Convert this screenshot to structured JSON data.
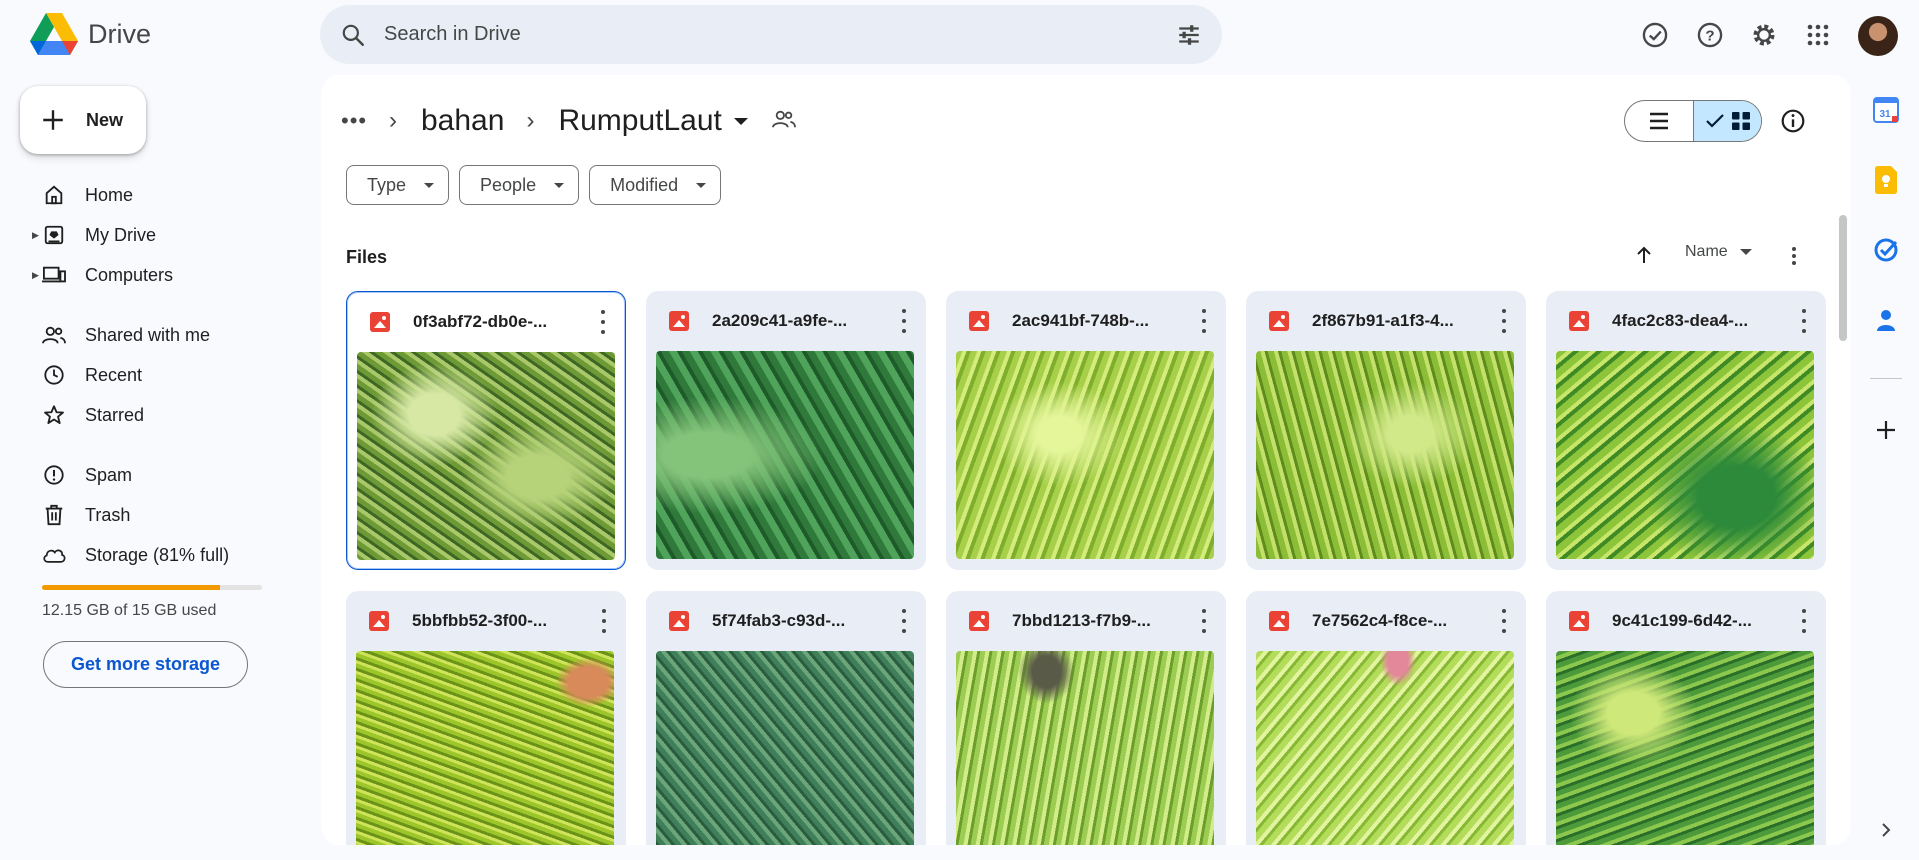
{
  "app": {
    "name": "Drive",
    "colors": {
      "accent": "#0b57d0",
      "storage": "#f29900",
      "selected_view": "#c2e7ff",
      "card_bg": "#e9eef6"
    }
  },
  "search": {
    "placeholder": "Search in Drive",
    "icon": "search-icon",
    "options_icon": "tune-icon"
  },
  "header_icons": [
    "ready-for-offline-icon",
    "help-icon",
    "settings-icon",
    "apps-grid-icon",
    "account-avatar"
  ],
  "sidebar": {
    "new_label": "New",
    "items": [
      {
        "label": "Home",
        "icon": "home-icon",
        "expandable": false
      },
      {
        "label": "My Drive",
        "icon": "my-drive-icon",
        "expandable": true
      },
      {
        "label": "Computers",
        "icon": "computers-icon",
        "expandable": true
      },
      {
        "label": "Shared with me",
        "icon": "shared-icon",
        "expandable": false
      },
      {
        "label": "Recent",
        "icon": "clock-icon",
        "expandable": false
      },
      {
        "label": "Starred",
        "icon": "star-icon",
        "expandable": false
      },
      {
        "label": "Spam",
        "icon": "spam-icon",
        "expandable": false
      },
      {
        "label": "Trash",
        "icon": "trash-icon",
        "expandable": false
      },
      {
        "label": "Storage (81% full)",
        "icon": "cloud-icon",
        "expandable": false
      }
    ],
    "storage": {
      "used_fraction": 0.81,
      "used_text": "12.15 GB of 15 GB used",
      "button_label": "Get more storage"
    }
  },
  "breadcrumb": {
    "items": [
      "bahan",
      "RumputLaut"
    ],
    "more_icon": "more-horiz-icon",
    "separator_icon": "chevron-right-icon",
    "share_icon": "shared-folder-icon"
  },
  "view": {
    "list_icon": "list-view-icon",
    "grid_icon": "grid-view-icon",
    "active": "grid",
    "info_icon": "info-icon"
  },
  "filters": [
    "Type",
    "People",
    "Modified"
  ],
  "files": {
    "section_label": "Files",
    "sort_label": "Name",
    "sort_direction": "ascending",
    "items": [
      {
        "name": "0f3abf72-db0e-...",
        "selected": true
      },
      {
        "name": "2a209c41-a9fe-...",
        "selected": false
      },
      {
        "name": "2ac941bf-748b-...",
        "selected": false
      },
      {
        "name": "2f867b91-a1f3-4...",
        "selected": false
      },
      {
        "name": "4fac2c83-dea4-...",
        "selected": false
      },
      {
        "name": "5bbfbb52-3f00-...",
        "selected": false
      },
      {
        "name": "5f74fab3-c93d-...",
        "selected": false
      },
      {
        "name": "7bbd1213-f7b9-...",
        "selected": false
      },
      {
        "name": "7e7562c4-f8ce-...",
        "selected": false
      },
      {
        "name": "9c41c199-6d42-...",
        "selected": false
      }
    ]
  },
  "side_panel": [
    "calendar-icon",
    "keep-icon",
    "tasks-icon",
    "contacts-icon",
    "add-icon",
    "collapse-panel-icon"
  ]
}
